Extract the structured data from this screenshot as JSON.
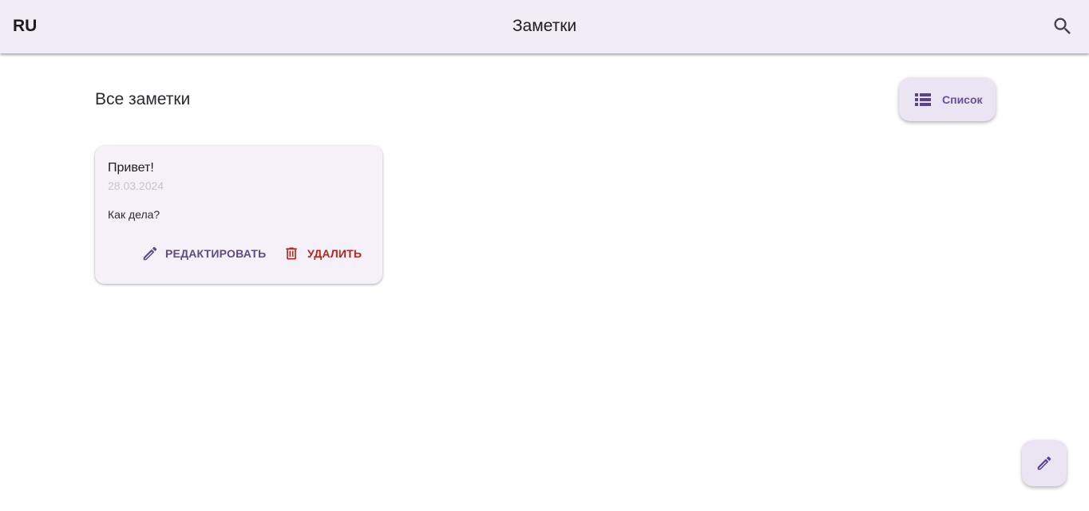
{
  "appbar": {
    "language": "RU",
    "title": "Заметки",
    "search_icon": "search-icon"
  },
  "main": {
    "section_title": "Все заметки",
    "view_toggle": {
      "label": "Список",
      "icon": "list-icon"
    }
  },
  "notes": [
    {
      "title": "Привет!",
      "date": "28.03.2024",
      "body": "Как дела?",
      "edit_label": "РЕДАКТИРОВАТЬ",
      "delete_label": "УДАЛИТЬ"
    }
  ],
  "fab": {
    "icon": "pencil-icon"
  },
  "colors": {
    "appbar_bg": "#f2ecf6",
    "accent": "#6a4e9e",
    "danger": "#b3261e",
    "card_bg": "#f6f1f8"
  }
}
